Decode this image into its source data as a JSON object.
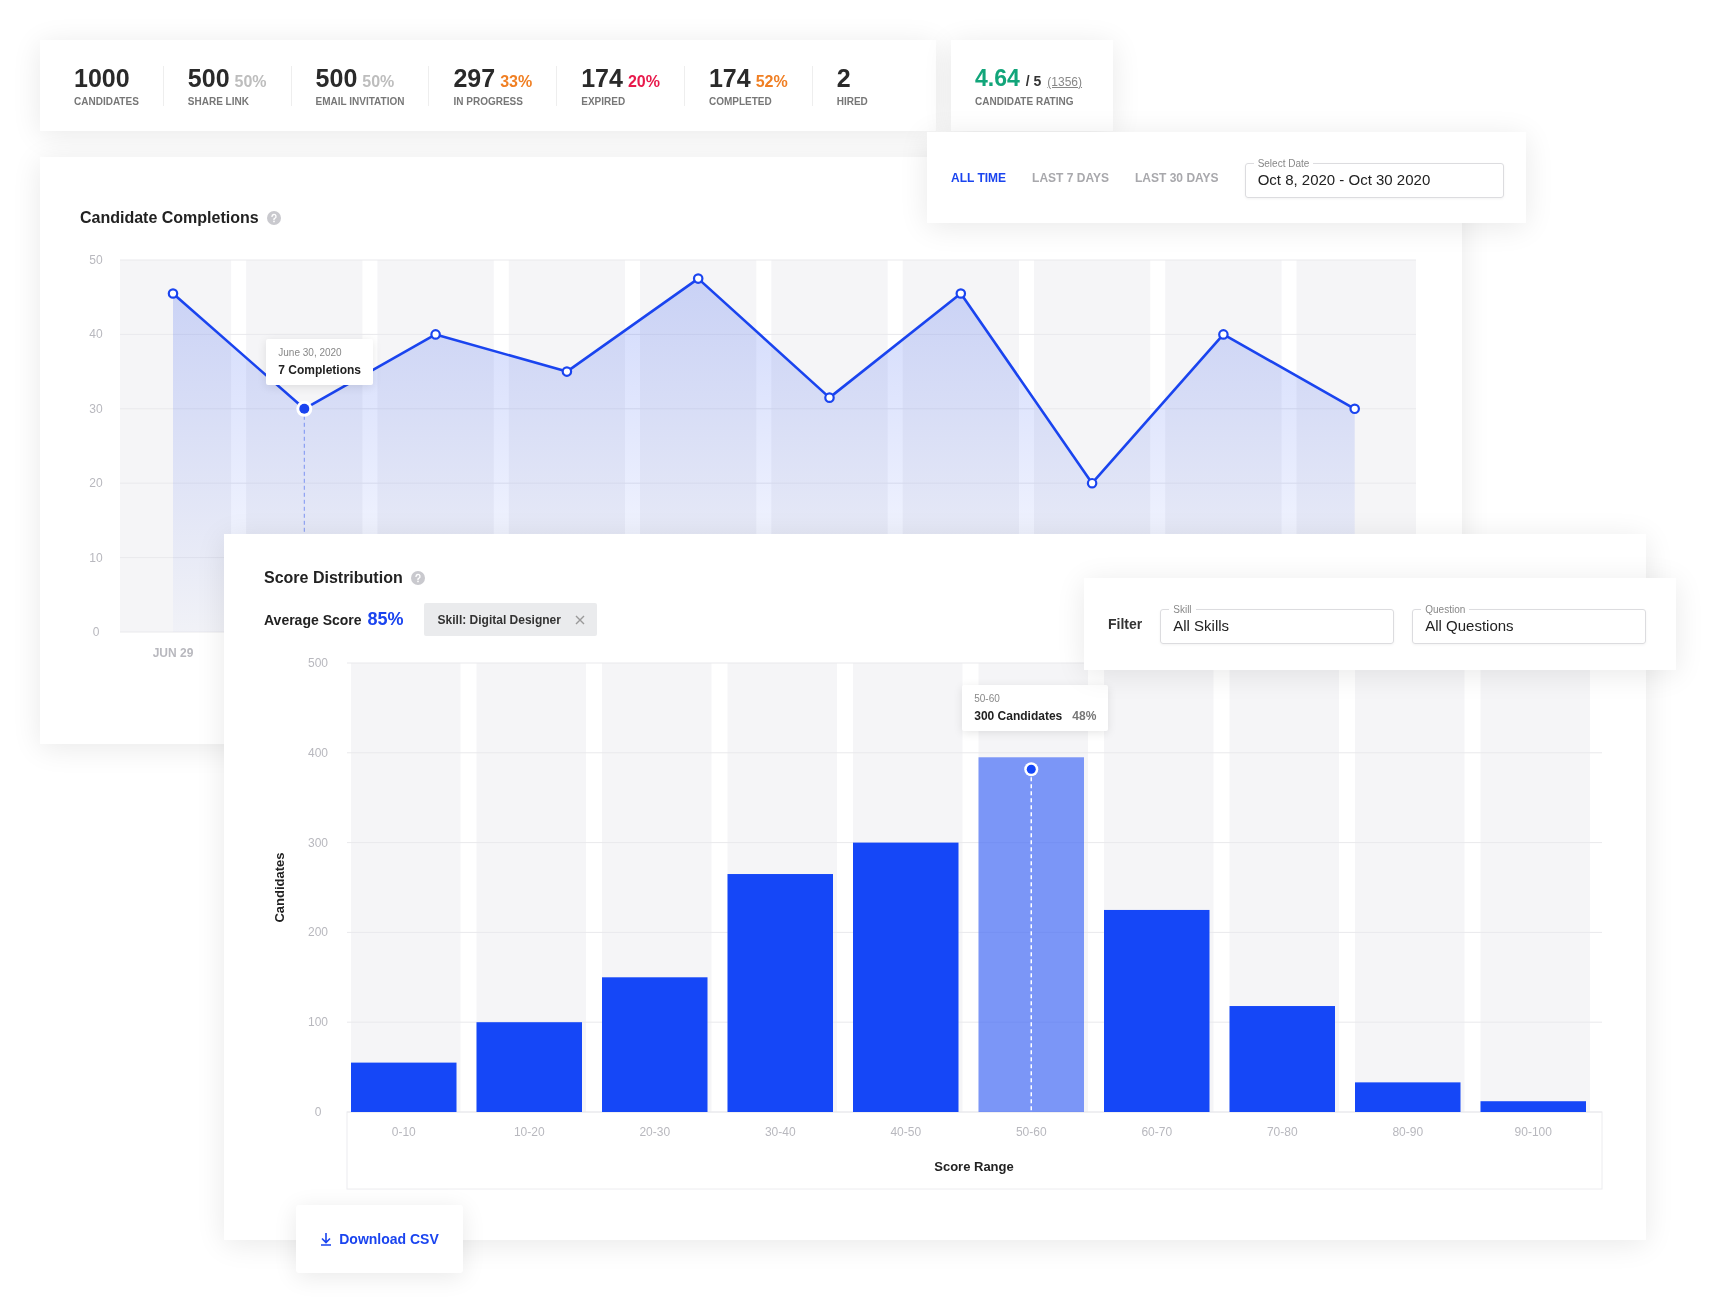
{
  "stats": [
    {
      "value": "1000",
      "label": "CANDIDATES"
    },
    {
      "value": "500",
      "share": "50%",
      "color": "#bdbdbd",
      "label": "SHARE LINK"
    },
    {
      "value": "500",
      "share": "50%",
      "color": "#bdbdbd",
      "label": "EMAIL INVITATION"
    },
    {
      "value": "297",
      "share": "33%",
      "color": "#f07f23",
      "label": "IN PROGRESS"
    },
    {
      "value": "174",
      "share": "20%",
      "color": "#e8194b",
      "label": "EXPIRED"
    },
    {
      "value": "174",
      "share": "52%",
      "color": "#f07f23",
      "label": "COMPLETED"
    },
    {
      "value": "2",
      "label": "HIRED"
    }
  ],
  "rating": {
    "score": "4.64",
    "out_of": "/ 5",
    "count": "(1356)",
    "label": "CANDIDATE RATING"
  },
  "date_filter": {
    "tabs": [
      {
        "label": "ALL TIME",
        "selected": true
      },
      {
        "label": "LAST 7 DAYS",
        "selected": false
      },
      {
        "label": "LAST 30 DAYS",
        "selected": false
      }
    ],
    "date_field": {
      "label": "Select Date",
      "value": "Oct 8, 2020 - Oct 30 2020"
    }
  },
  "completions": {
    "title": "Candidate Completions",
    "first_date_label": "JUN 29",
    "tooltip": {
      "date": "June 30, 2020",
      "text": "7 Completions"
    },
    "points": [
      {
        "selected": false
      },
      {
        "selected": true
      },
      {
        "selected": false
      },
      {
        "selected": false
      },
      {
        "selected": false
      },
      {
        "selected": false
      },
      {
        "selected": false
      },
      {
        "selected": false
      },
      {
        "selected": false
      },
      {
        "selected": false
      }
    ],
    "chart_data": {
      "type": "area",
      "ylim": [
        0,
        50
      ],
      "yticks": [
        0,
        10,
        20,
        30,
        40,
        50
      ],
      "grid": true,
      "series": [
        {
          "color": "#1a44ef",
          "values": [
            45.5,
            30,
            40,
            35,
            47.5,
            31.5,
            45.5,
            20,
            40,
            30
          ]
        }
      ]
    }
  },
  "score_distribution": {
    "title": "Score Distribution",
    "average_label": "Average Score",
    "average_value": "85%",
    "chip": "Skill: Digital Designer",
    "tooltip": {
      "range": "50-60",
      "text": "300 Candidates",
      "share": "48%"
    },
    "bars": [
      {
        "selected": false
      },
      {
        "selected": false
      },
      {
        "selected": false
      },
      {
        "selected": false
      },
      {
        "selected": false
      },
      {
        "selected": true
      },
      {
        "selected": false
      },
      {
        "selected": false
      },
      {
        "selected": false
      },
      {
        "selected": false
      }
    ],
    "chart_data": {
      "type": "bar",
      "categories": [
        "0-10",
        "10-20",
        "20-30",
        "30-40",
        "40-50",
        "50-60",
        "60-70",
        "70-80",
        "80-90",
        "90-100"
      ],
      "xlabel": "Score Range",
      "ylabel": "Candidates",
      "ylim": [
        0,
        500
      ],
      "yticks": [
        0,
        100,
        200,
        300,
        400,
        {
          "value": 500,
          "label": "500"
        }
      ],
      "grid": true,
      "series": [
        {
          "color": "#1547f7",
          "values": [
            55,
            100,
            150,
            265,
            300,
            395,
            225,
            118,
            33,
            12
          ]
        }
      ]
    }
  },
  "filter": {
    "label": "Filter",
    "fields": [
      {
        "label": "Skill",
        "value": "All Skills"
      },
      {
        "label": "Question",
        "value": "All Questions"
      }
    ]
  },
  "download": {
    "label": "Download CSV"
  }
}
